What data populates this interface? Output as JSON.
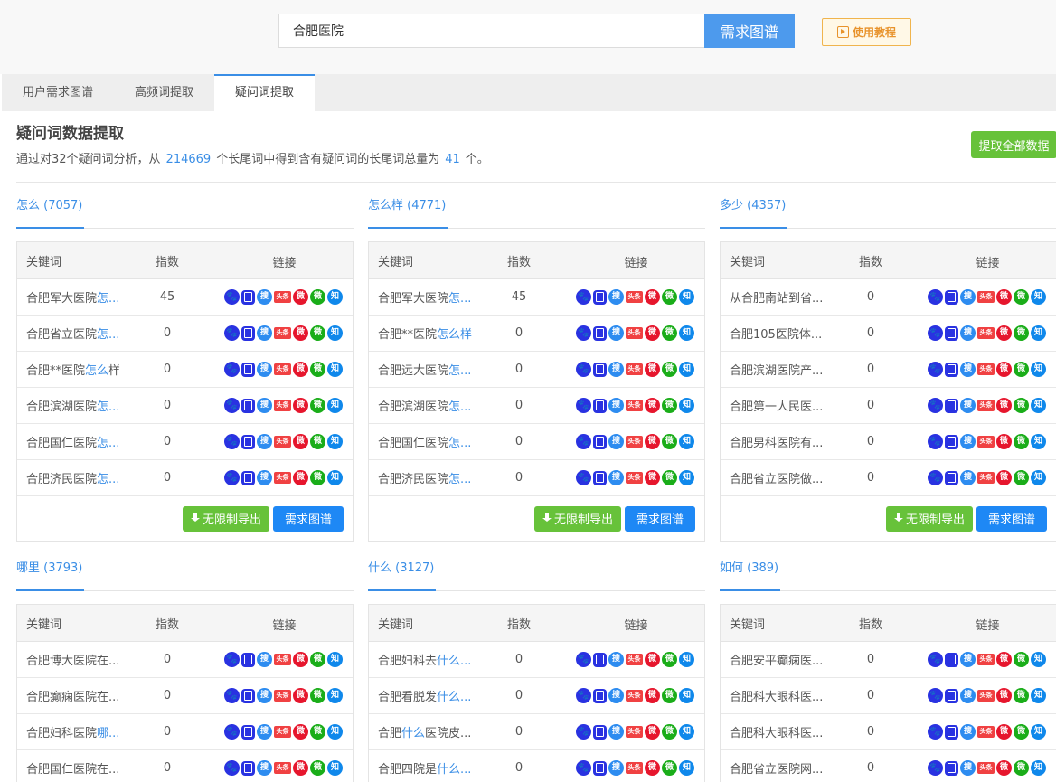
{
  "search": {
    "value": "合肥医院",
    "button": "需求图谱"
  },
  "tutorial_label": "使用教程",
  "tabs": [
    "用户需求图谱",
    "高频词提取",
    "疑问词提取"
  ],
  "section": {
    "title": "疑问词数据提取",
    "desc_prefix": "通过对32个疑问词分析，从",
    "total_longtail": "214669",
    "desc_mid": "个长尾词中得到含有疑问词的长尾词总量为",
    "found": "41",
    "desc_suffix": "个。",
    "extract_all": "提取全部数据"
  },
  "table_header": {
    "keyword": "关键词",
    "index": "指数",
    "links": "链接"
  },
  "buttons": {
    "export": "无限制导出",
    "map": "需求图谱"
  },
  "icon_labels": {
    "baidu": "🐾",
    "so": "搜",
    "toutiao": "头条",
    "weibo": "微",
    "wechat": "微",
    "zhihu": "知"
  },
  "panels": [
    {
      "title": "怎么 (7057)",
      "rows": [
        {
          "pre": "合肥军大医院",
          "hl": "怎...",
          "post": "",
          "index": "45"
        },
        {
          "pre": "合肥省立医院",
          "hl": "怎...",
          "post": "",
          "index": "0"
        },
        {
          "pre": "合肥**医院",
          "hl": "怎么",
          "post": "样",
          "index": "0"
        },
        {
          "pre": "合肥滨湖医院",
          "hl": "怎...",
          "post": "",
          "index": "0"
        },
        {
          "pre": "合肥国仁医院",
          "hl": "怎...",
          "post": "",
          "index": "0"
        },
        {
          "pre": "合肥济民医院",
          "hl": "怎...",
          "post": "",
          "index": "0"
        }
      ]
    },
    {
      "title": "怎么样 (4771)",
      "rows": [
        {
          "pre": "合肥军大医院",
          "hl": "怎...",
          "post": "",
          "index": "45"
        },
        {
          "pre": "合肥**医院",
          "hl": "怎么样",
          "post": "",
          "index": "0"
        },
        {
          "pre": "合肥远大医院",
          "hl": "怎...",
          "post": "",
          "index": "0"
        },
        {
          "pre": "合肥滨湖医院",
          "hl": "怎...",
          "post": "",
          "index": "0"
        },
        {
          "pre": "合肥国仁医院",
          "hl": "怎...",
          "post": "",
          "index": "0"
        },
        {
          "pre": "合肥济民医院",
          "hl": "怎...",
          "post": "",
          "index": "0"
        }
      ]
    },
    {
      "title": "多少 (4357)",
      "rows": [
        {
          "pre": "从合肥南站到省...",
          "hl": "",
          "post": "",
          "index": "0"
        },
        {
          "pre": "合肥105医院体...",
          "hl": "",
          "post": "",
          "index": "0"
        },
        {
          "pre": "合肥滨湖医院产...",
          "hl": "",
          "post": "",
          "index": "0"
        },
        {
          "pre": "合肥第一人民医...",
          "hl": "",
          "post": "",
          "index": "0"
        },
        {
          "pre": "合肥男科医院有...",
          "hl": "",
          "post": "",
          "index": "0"
        },
        {
          "pre": "合肥省立医院做...",
          "hl": "",
          "post": "",
          "index": "0"
        }
      ]
    },
    {
      "title": "哪里 (3793)",
      "rows": [
        {
          "pre": "合肥博大医院在...",
          "hl": "",
          "post": "",
          "index": "0"
        },
        {
          "pre": "合肥癫痫医院在...",
          "hl": "",
          "post": "",
          "index": "0"
        },
        {
          "pre": "合肥妇科医院",
          "hl": "哪...",
          "post": "",
          "index": "0"
        },
        {
          "pre": "合肥国仁医院在...",
          "hl": "",
          "post": "",
          "index": "0"
        }
      ]
    },
    {
      "title": "什么 (3127)",
      "rows": [
        {
          "pre": "合肥妇科去",
          "hl": "什么...",
          "post": "",
          "index": "0"
        },
        {
          "pre": "合肥看脱发",
          "hl": "什么...",
          "post": "",
          "index": "0"
        },
        {
          "pre": "合肥",
          "hl": "什么",
          "post": "医院皮...",
          "index": "0"
        },
        {
          "pre": "合肥四院是",
          "hl": "什么...",
          "post": "",
          "index": "0"
        }
      ]
    },
    {
      "title": "如何 (389)",
      "rows": [
        {
          "pre": "合肥安平癫痫医...",
          "hl": "",
          "post": "",
          "index": "0"
        },
        {
          "pre": "合肥科大眼科医...",
          "hl": "",
          "post": "",
          "index": "0"
        },
        {
          "pre": "合肥科大眼科医...",
          "hl": "",
          "post": "",
          "index": "0"
        },
        {
          "pre": "合肥省立医院网...",
          "hl": "",
          "post": "",
          "index": "0"
        }
      ]
    }
  ],
  "colors": {
    "accent": "#3a8ee6",
    "green": "#67c23a",
    "search_btn": "#4d9aed",
    "tutorial": "#e8932c"
  }
}
